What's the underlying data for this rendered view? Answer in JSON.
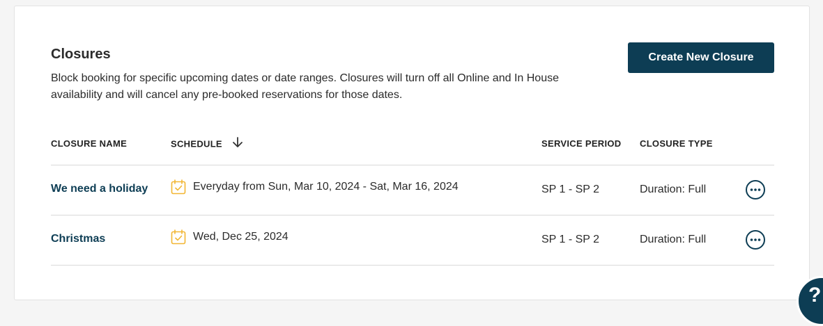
{
  "section": {
    "title": "Closures",
    "description": "Block booking for specific upcoming dates or date ranges. Closures will turn off all Online and In House availability and will cancel any pre-booked reservations for those dates.",
    "create_button_label": "Create New Closure"
  },
  "table": {
    "headers": {
      "closure_name": "CLOSURE NAME",
      "schedule": "SCHEDULE",
      "service_period": "SERVICE PERIOD",
      "closure_type": "CLOSURE TYPE"
    },
    "rows": [
      {
        "name": "We need a holiday",
        "schedule": "Everyday from Sun, Mar 10, 2024 - Sat, Mar 16, 2024",
        "service_period": "SP 1 - SP 2",
        "closure_type": "Duration: Full"
      },
      {
        "name": "Christmas",
        "schedule": "Wed, Dec 25, 2024",
        "service_period": "SP 1 - SP 2",
        "closure_type": "Duration: Full"
      }
    ]
  },
  "help": {
    "label": "?"
  },
  "icons": {
    "sort": "arrow-down-icon",
    "calendar": "calendar-check-icon",
    "more": "more-horizontal-icon",
    "help": "help-icon"
  },
  "colors": {
    "primary": "#0d3d54",
    "calendar_accent": "#f2b632",
    "divider": "#d9d9d9",
    "background": "#f5f5f5"
  }
}
